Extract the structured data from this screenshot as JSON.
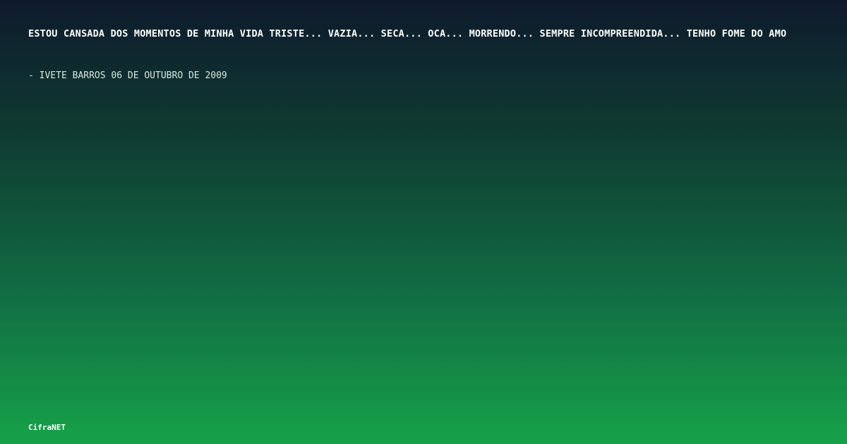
{
  "card": {
    "quote": "ESTOU CANSADA DOS MOMENTOS DE MINHA VIDA TRISTE... VAZIA... SECA... OCA... MORRENDO... SEMPRE INCOMPREENDIDA... TENHO FOME DO AMO",
    "author_line": "- IVETE BARROS 06 DE OUTUBRO DE 2009",
    "brand": "CifraNET"
  },
  "colors": {
    "gradient_top": "#0e1a2d",
    "gradient_bottom": "#16a249",
    "text": "#ffffff"
  }
}
